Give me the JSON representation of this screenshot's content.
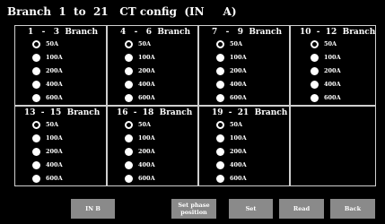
{
  "title": "Branch  1  to  21   CT config  (IN     A)",
  "branches": [
    {
      "label": "1   -   3  Branch",
      "options": [
        "50A",
        "100A",
        "200A",
        "400A",
        "600A"
      ],
      "selected": 0
    },
    {
      "label": "4   -   6  Branch",
      "options": [
        "50A",
        "100A",
        "200A",
        "400A",
        "600A"
      ],
      "selected": 0
    },
    {
      "label": "7   -   9  Branch",
      "options": [
        "50A",
        "100A",
        "200A",
        "400A",
        "600A"
      ],
      "selected": 0
    },
    {
      "label": "10  -  12  Branch",
      "options": [
        "50A",
        "100A",
        "200A",
        "400A",
        "600A"
      ],
      "selected": 0
    },
    {
      "label": "13  -  15  Branch",
      "options": [
        "50A",
        "100A",
        "200A",
        "400A",
        "600A"
      ],
      "selected": 0
    },
    {
      "label": "16  -  18  Branch",
      "options": [
        "50A",
        "100A",
        "200A",
        "400A",
        "600A"
      ],
      "selected": 0
    },
    {
      "label": "19  -  21  Branch",
      "options": [
        "50A",
        "100A",
        "200A",
        "400A",
        "600A"
      ],
      "selected": 0
    }
  ],
  "buttons": {
    "inb": "IN B",
    "set_phase": "Set phase\nposition",
    "set": "Set",
    "read": "Read",
    "back": "Back"
  },
  "colors": {
    "background": "#000000",
    "text": "#ffffff",
    "button": "#8a8a8a",
    "border": "#cfcfcf"
  }
}
